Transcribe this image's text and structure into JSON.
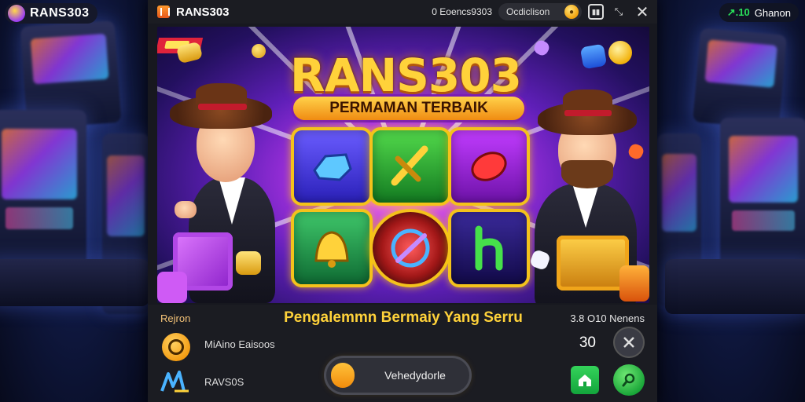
{
  "top_left": {
    "brand": "RANS303"
  },
  "top_right": {
    "signal": "↗.10",
    "label": "Ghanon"
  },
  "window": {
    "title": "RANS303",
    "balance_text": "0 Eoencs9303",
    "field_text": "Ocdiclison"
  },
  "banner": {
    "title": "RANS303",
    "subtitle": "PERMAMAN TERBAIK"
  },
  "panel": {
    "left_label": "Rejron",
    "headline": "Pengalemmn Bermaiy Yang Serru",
    "right_label": "3.8 O10 Nenens",
    "username": "MiAino Eaisoos",
    "score": "30",
    "logo_name": "RAVS0S",
    "play_label": "Vehedydorle"
  },
  "colors": {
    "accent_gold": "#ffd23a",
    "accent_orange": "#f28c0c",
    "accent_green": "#16a336",
    "window_bg": "#17181f"
  }
}
